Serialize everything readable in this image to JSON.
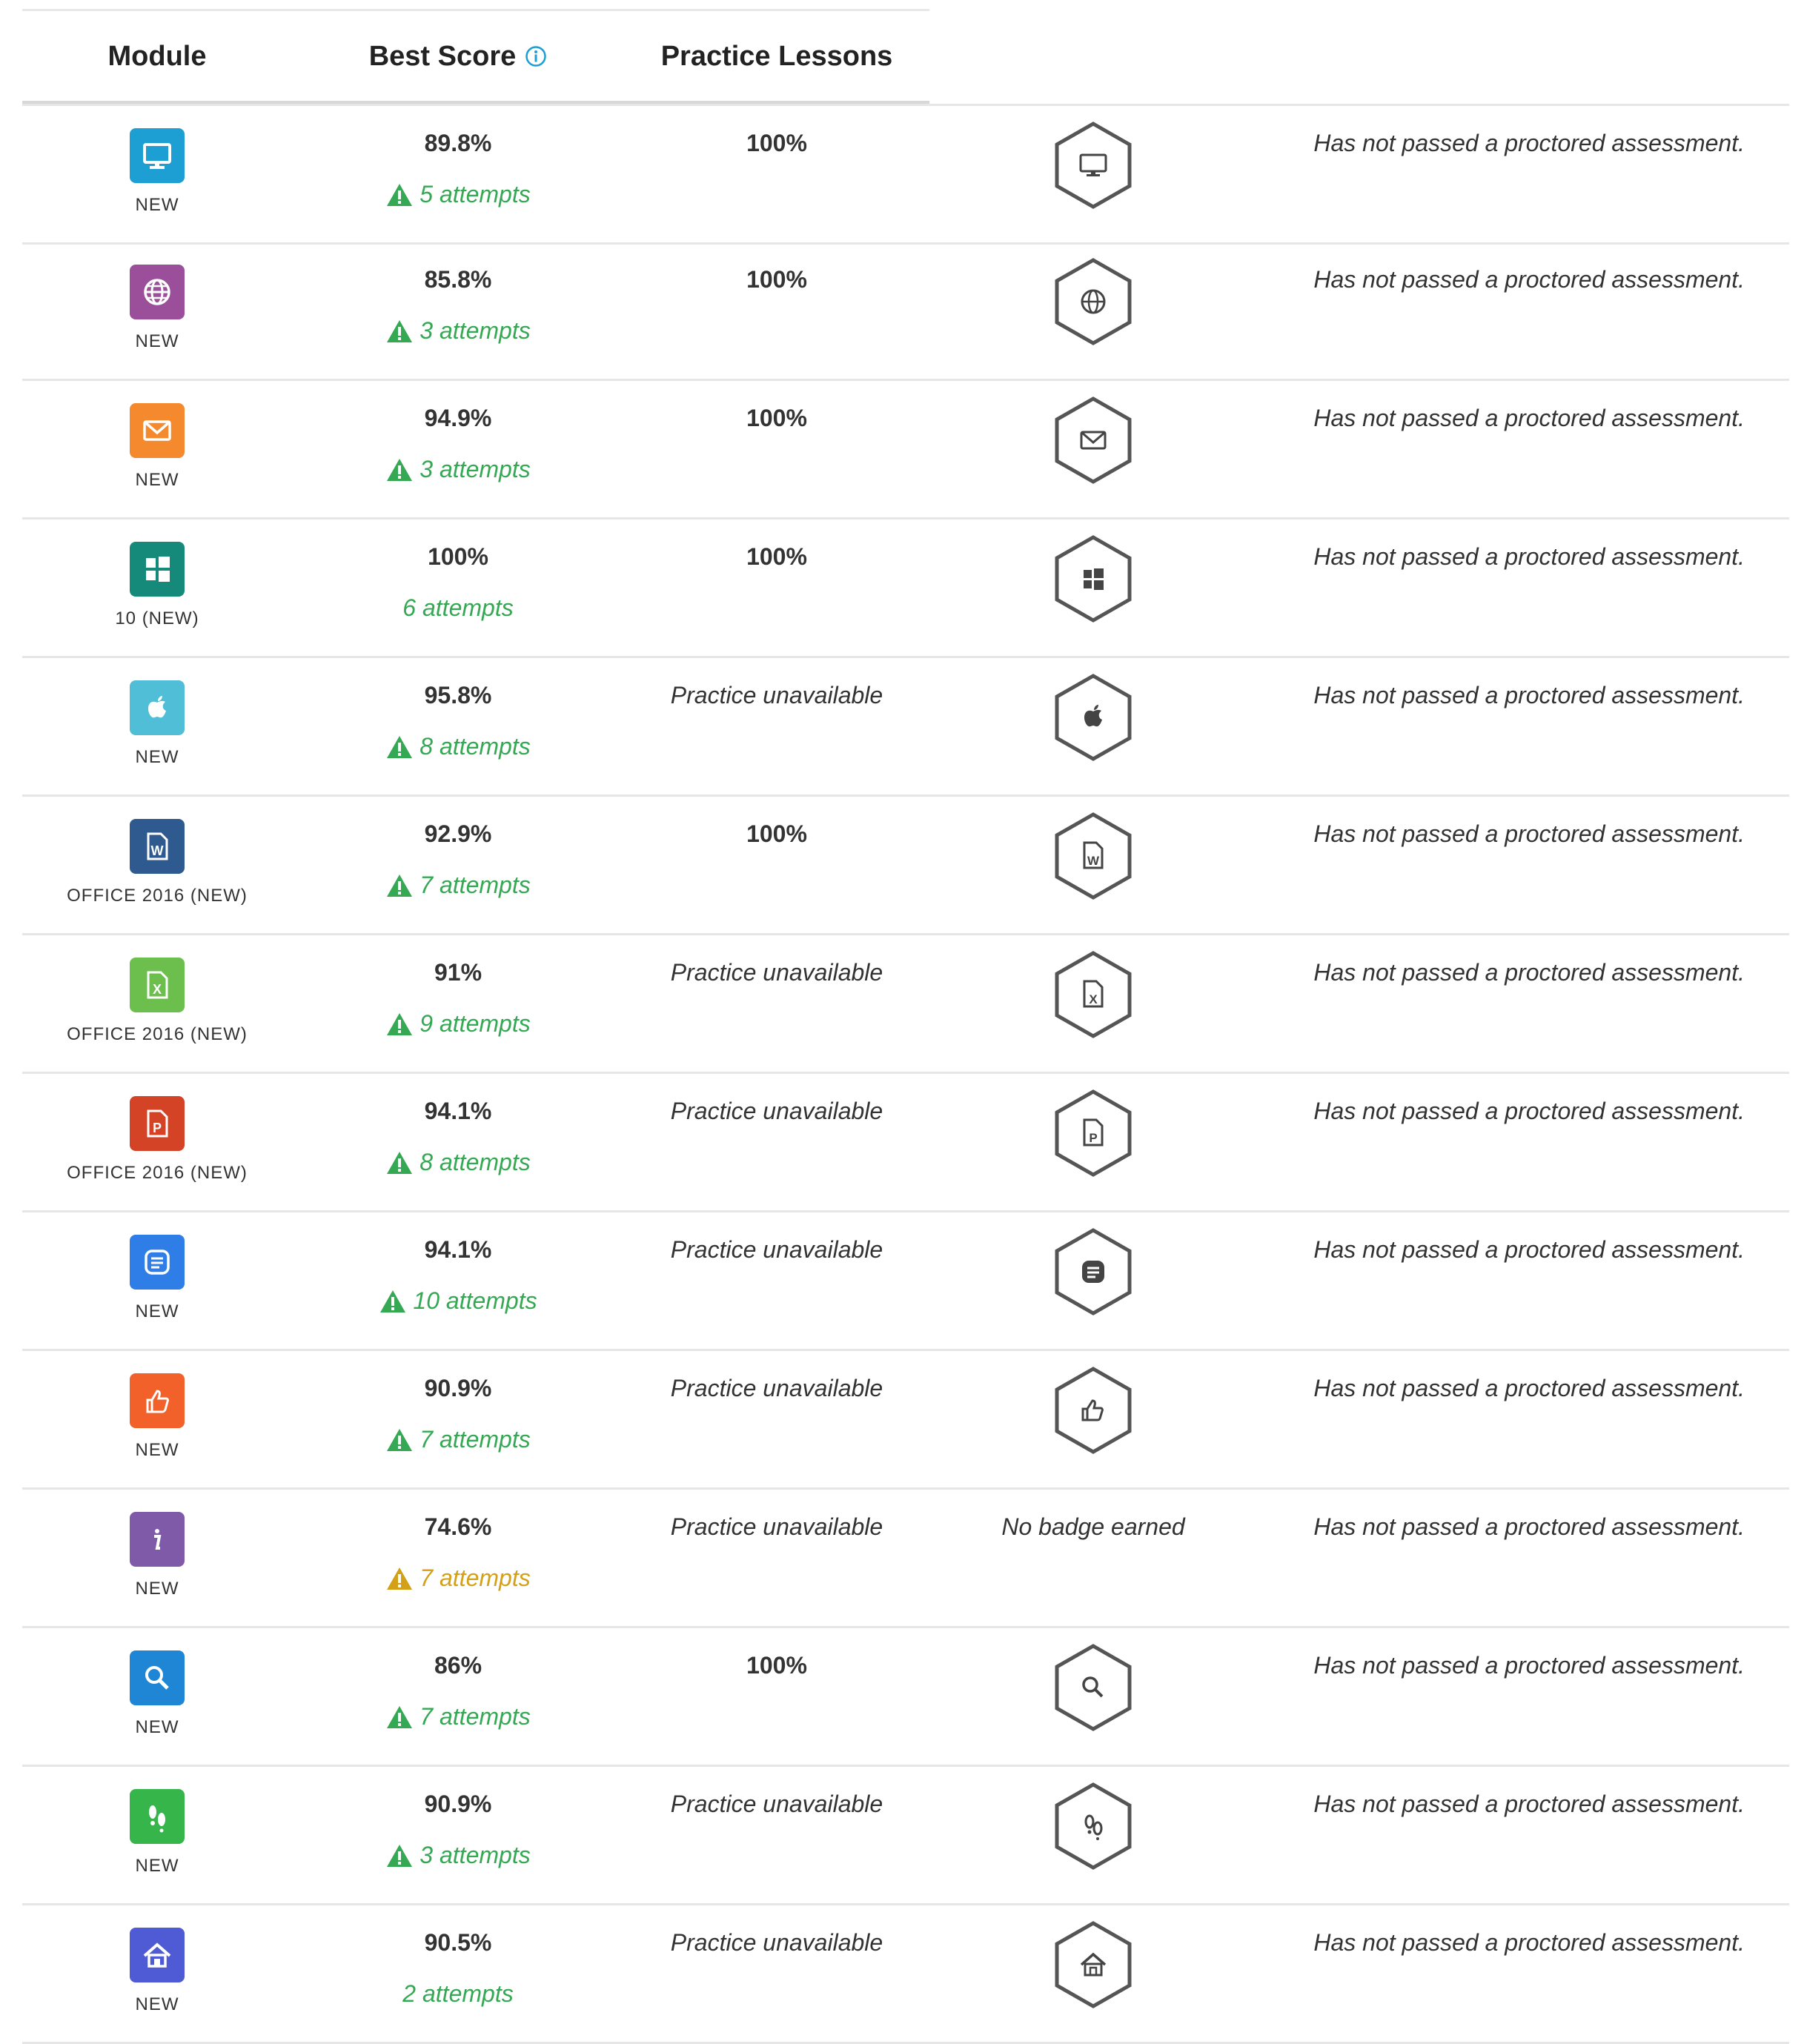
{
  "header": {
    "module": "Module",
    "best_score": "Best Score",
    "practice_lessons": "Practice Lessons"
  },
  "colors": {
    "success": "#34a853",
    "warning": "#d4a017",
    "badge_stroke": "#555555"
  },
  "rows": [
    {
      "icon": "monitor-icon",
      "icon_color": "#1e9fd4",
      "label": "NEW",
      "score": "89.8%",
      "attempts": "5 attempts",
      "attempt_status": "warning-green",
      "practice": "100%",
      "badge": "monitor",
      "status": "Has not passed a proctored assessment."
    },
    {
      "icon": "globe-icon",
      "icon_color": "#9b4f9a",
      "label": "NEW",
      "score": "85.8%",
      "attempts": "3 attempts",
      "attempt_status": "warning-green",
      "practice": "100%",
      "badge": "globe",
      "status": "Has not passed a proctored assessment."
    },
    {
      "icon": "mail-icon",
      "icon_color": "#f5892d",
      "label": "NEW",
      "score": "94.9%",
      "attempts": "3 attempts",
      "attempt_status": "warning-green",
      "practice": "100%",
      "badge": "mail",
      "status": "Has not passed a proctored assessment."
    },
    {
      "icon": "windows-icon",
      "icon_color": "#15897a",
      "label": "10 (NEW)",
      "score": "100%",
      "attempts": "6 attempts",
      "attempt_status": "plain-green",
      "practice": "100%",
      "badge": "windows",
      "status": "Has not passed a proctored assessment."
    },
    {
      "icon": "apple-icon",
      "icon_color": "#4fbed6",
      "label": "NEW",
      "score": "95.8%",
      "attempts": "8 attempts",
      "attempt_status": "warning-green",
      "practice": "Practice unavailable",
      "badge": "apple",
      "status": "Has not passed a proctored assessment."
    },
    {
      "icon": "word-icon",
      "icon_color": "#2f5a8f",
      "label": "OFFICE 2016 (NEW)",
      "score": "92.9%",
      "attempts": "7 attempts",
      "attempt_status": "warning-green",
      "practice": "100%",
      "badge": "word",
      "status": "Has not passed a proctored assessment."
    },
    {
      "icon": "excel-icon",
      "icon_color": "#6cbf4d",
      "label": "OFFICE 2016 (NEW)",
      "score": "91%",
      "attempts": "9 attempts",
      "attempt_status": "warning-green",
      "practice": "Practice unavailable",
      "badge": "excel",
      "status": "Has not passed a proctored assessment."
    },
    {
      "icon": "powerpoint-icon",
      "icon_color": "#d54326",
      "label": "OFFICE 2016 (NEW)",
      "score": "94.1%",
      "attempts": "8 attempts",
      "attempt_status": "warning-green",
      "practice": "Practice unavailable",
      "badge": "powerpoint",
      "status": "Has not passed a proctored assessment."
    },
    {
      "icon": "document-icon",
      "icon_color": "#2f7ee8",
      "label": "NEW",
      "score": "94.1%",
      "attempts": "10 attempts",
      "attempt_status": "warning-green",
      "practice": "Practice unavailable",
      "badge": "document",
      "status": "Has not passed a proctored assessment."
    },
    {
      "icon": "thumbs-up-icon",
      "icon_color": "#f2612a",
      "label": "NEW",
      "score": "90.9%",
      "attempts": "7 attempts",
      "attempt_status": "warning-green",
      "practice": "Practice unavailable",
      "badge": "thumbs-up",
      "status": "Has not passed a proctored assessment."
    },
    {
      "icon": "info-icon",
      "icon_color": "#7e5aa8",
      "label": "NEW",
      "score": "74.6%",
      "attempts": "7 attempts",
      "attempt_status": "warning-orange",
      "practice": "Practice unavailable",
      "badge": "none",
      "badge_text": "No badge earned",
      "status": "Has not passed a proctored assessment."
    },
    {
      "icon": "magnifier-icon",
      "icon_color": "#1f86d6",
      "label": "NEW",
      "score": "86%",
      "attempts": "7 attempts",
      "attempt_status": "warning-green",
      "practice": "100%",
      "badge": "magnifier",
      "status": "Has not passed a proctored assessment."
    },
    {
      "icon": "footprints-icon",
      "icon_color": "#35b54a",
      "label": "NEW",
      "score": "90.9%",
      "attempts": "3 attempts",
      "attempt_status": "warning-green",
      "practice": "Practice unavailable",
      "badge": "footprints",
      "status": "Has not passed a proctored assessment."
    },
    {
      "icon": "home-icon",
      "icon_color": "#4f5bd5",
      "label": "NEW",
      "score": "90.5%",
      "attempts": "2 attempts",
      "attempt_status": "plain-green",
      "practice": "Practice unavailable",
      "badge": "home",
      "status": "Has not passed a proctored assessment."
    }
  ]
}
